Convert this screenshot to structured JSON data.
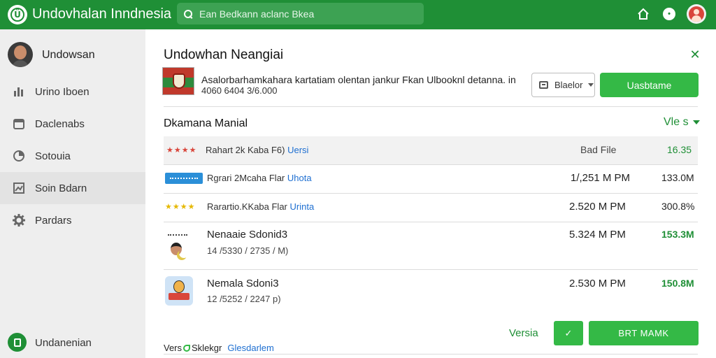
{
  "header": {
    "app_title": "Undovhalan Inndnesia",
    "search_placeholder": "Ean Bedkann aclanc Bkea",
    "icons": [
      "app-logo-icon",
      "search-icon",
      "home-icon",
      "info-icon",
      "user-avatar-icon"
    ]
  },
  "sidebar": {
    "profile_name": "Undowsan",
    "items": [
      {
        "label": "Urino Iboen",
        "icon": "chart-icon"
      },
      {
        "label": "Daclenabs",
        "icon": "calendar-icon"
      },
      {
        "label": "Sotouia",
        "icon": "clock-icon"
      },
      {
        "label": "Soin Bdarn",
        "icon": "image-icon"
      },
      {
        "label": "Pardars",
        "icon": "gear-icon"
      }
    ],
    "footer_label": "Undanenian"
  },
  "dialog": {
    "title": "Undowhan Neangiai",
    "close_icon": "close-icon",
    "description_line1": "Asalorbarhamkahara kartatiam olentan jankur Fkan Ulbooknl detanna. in",
    "description_line2": "4060 6404 3/6.000",
    "select_label": "Blaelor",
    "primary_button": "Uasbtame"
  },
  "section": {
    "title": "Dkamana Manial",
    "view_label": "Vle s"
  },
  "table": {
    "header": {
      "stars": "★★★★",
      "text": "Rahart 2k Kaba F6)",
      "link": "Uersi",
      "col_b": "Bad File",
      "col_c": "16.35"
    },
    "rows": [
      {
        "text": "Rgrari 2Mcaha Flar",
        "link": "Uhota",
        "time": "1/,251 M PM",
        "size": "133.0M",
        "size_green": false
      },
      {
        "stars": "★★★★",
        "text": "Rarartio.KKaba Flar",
        "link": "Urinta",
        "time": "2.520 M PM",
        "size": "300.8%",
        "size_green": false
      },
      {
        "title": "Nenaaie Sdonid3",
        "meta": "14 /5330 / 2735 / M)",
        "time": "5.324 M PM",
        "size": "153.3M",
        "size_green": true
      },
      {
        "title": "Nemala Sdoni3",
        "meta": "12 /5252 / 2247 p)",
        "time": "2.530 M PM",
        "size": "150.8M",
        "size_green": true
      }
    ]
  },
  "footer": {
    "versi_label": "Versia",
    "check_label": "✓",
    "big_button": "BRT MAMK",
    "note_prefix": "Vers",
    "note_middle": "Sklekgr",
    "note_link": "Glesdarlem"
  },
  "colors": {
    "brand_green": "#1f8f36",
    "button_green": "#34b946",
    "link_blue": "#1e6fd1",
    "sidebar_bg": "#eeeeee"
  }
}
